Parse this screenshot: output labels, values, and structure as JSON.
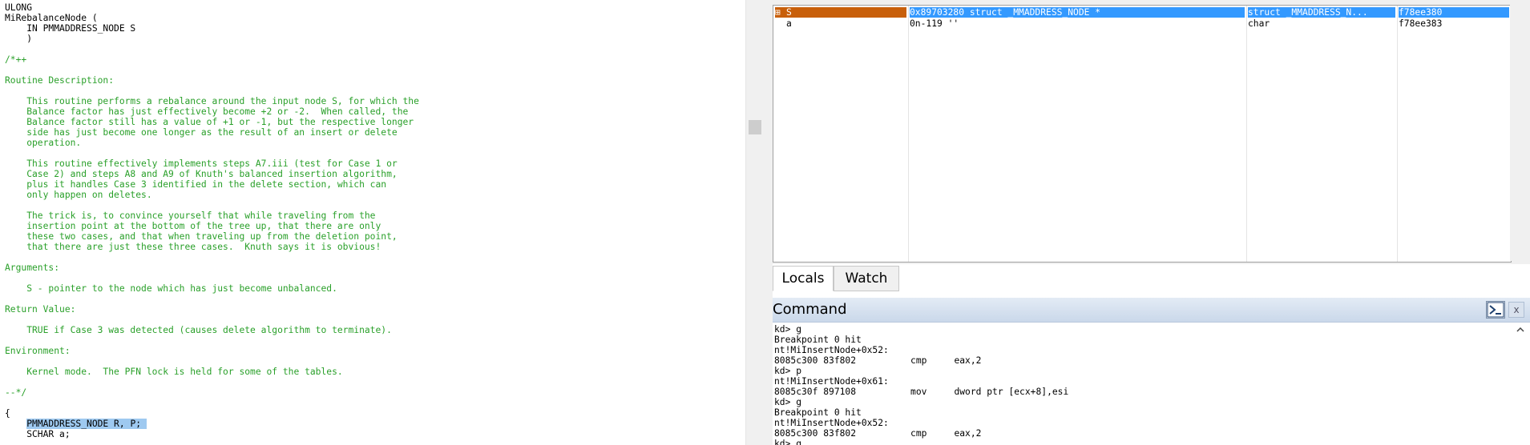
{
  "source": {
    "lines": [
      {
        "t": "ULONG",
        "c": false
      },
      {
        "t": "MiRebalanceNode (",
        "c": false
      },
      {
        "t": "    IN PMMADDRESS_NODE S",
        "c": false
      },
      {
        "t": "    )",
        "c": false
      },
      {
        "t": "",
        "c": false
      },
      {
        "t": "/*++",
        "c": true
      },
      {
        "t": "",
        "c": true
      },
      {
        "t": "Routine Description:",
        "c": true
      },
      {
        "t": "",
        "c": true
      },
      {
        "t": "    This routine performs a rebalance around the input node S, for which the",
        "c": true
      },
      {
        "t": "    Balance factor has just effectively become +2 or -2.  When called, the",
        "c": true
      },
      {
        "t": "    Balance factor still has a value of +1 or -1, but the respective longer",
        "c": true
      },
      {
        "t": "    side has just become one longer as the result of an insert or delete",
        "c": true
      },
      {
        "t": "    operation.",
        "c": true
      },
      {
        "t": "",
        "c": true
      },
      {
        "t": "    This routine effectively implements steps A7.iii (test for Case 1 or",
        "c": true
      },
      {
        "t": "    Case 2) and steps A8 and A9 of Knuth's balanced insertion algorithm,",
        "c": true
      },
      {
        "t": "    plus it handles Case 3 identified in the delete section, which can",
        "c": true
      },
      {
        "t": "    only happen on deletes.",
        "c": true
      },
      {
        "t": "",
        "c": true
      },
      {
        "t": "    The trick is, to convince yourself that while traveling from the",
        "c": true
      },
      {
        "t": "    insertion point at the bottom of the tree up, that there are only",
        "c": true
      },
      {
        "t": "    these two cases, and that when traveling up from the deletion point,",
        "c": true
      },
      {
        "t": "    that there are just these three cases.  Knuth says it is obvious!",
        "c": true
      },
      {
        "t": "",
        "c": true
      },
      {
        "t": "Arguments:",
        "c": true
      },
      {
        "t": "",
        "c": true
      },
      {
        "t": "    S - pointer to the node which has just become unbalanced.",
        "c": true
      },
      {
        "t": "",
        "c": true
      },
      {
        "t": "Return Value:",
        "c": true
      },
      {
        "t": "",
        "c": true
      },
      {
        "t": "    TRUE if Case 3 was detected (causes delete algorithm to terminate).",
        "c": true
      },
      {
        "t": "",
        "c": true
      },
      {
        "t": "Environment:",
        "c": true
      },
      {
        "t": "",
        "c": true
      },
      {
        "t": "    Kernel mode.  The PFN lock is held for some of the tables.",
        "c": true
      },
      {
        "t": "",
        "c": true
      },
      {
        "t": "--*/",
        "c": true
      },
      {
        "t": "",
        "c": false
      },
      {
        "t": "{",
        "c": false
      },
      {
        "t": "    PMMADDRESS_NODE R, P;",
        "c": false,
        "sel": true
      },
      {
        "t": "    SCHAR a;",
        "c": false
      }
    ]
  },
  "locals": {
    "rows": [
      {
        "expand": "⊞",
        "name": "S",
        "value": "0x89703280 struct _MMADDRESS_NODE *",
        "type": "struct _MMADDRESS_N...",
        "location": "f78ee380",
        "selected": true
      },
      {
        "expand": "",
        "name": "a",
        "value": "0n-119 ''",
        "type": "char",
        "location": "f78ee383",
        "selected": false
      }
    ],
    "colors": {
      "name_selected_bg": "#c85f0a",
      "selected_bg": "#3399ff",
      "selected_fg": "#ffffff"
    }
  },
  "tabs": [
    {
      "label": "Locals",
      "active": true
    },
    {
      "label": "Watch",
      "active": false
    }
  ],
  "command": {
    "title": "Command",
    "close_glyph": "x",
    "output": [
      "kd> g",
      "Breakpoint 0 hit",
      "nt!MiInsertNode+0x52:",
      "8085c300 83f802          cmp     eax,2",
      "kd> p",
      "nt!MiInsertNode+0x61:",
      "8085c30f 897108          mov     dword ptr [ecx+8],esi",
      "kd> g",
      "Breakpoint 0 hit",
      "nt!MiInsertNode+0x52:",
      "8085c300 83f802          cmp     eax,2",
      "kd> g"
    ]
  },
  "icons": {
    "command_prompt": "command-prompt-icon",
    "scroll_up": "chevron-up-icon"
  }
}
